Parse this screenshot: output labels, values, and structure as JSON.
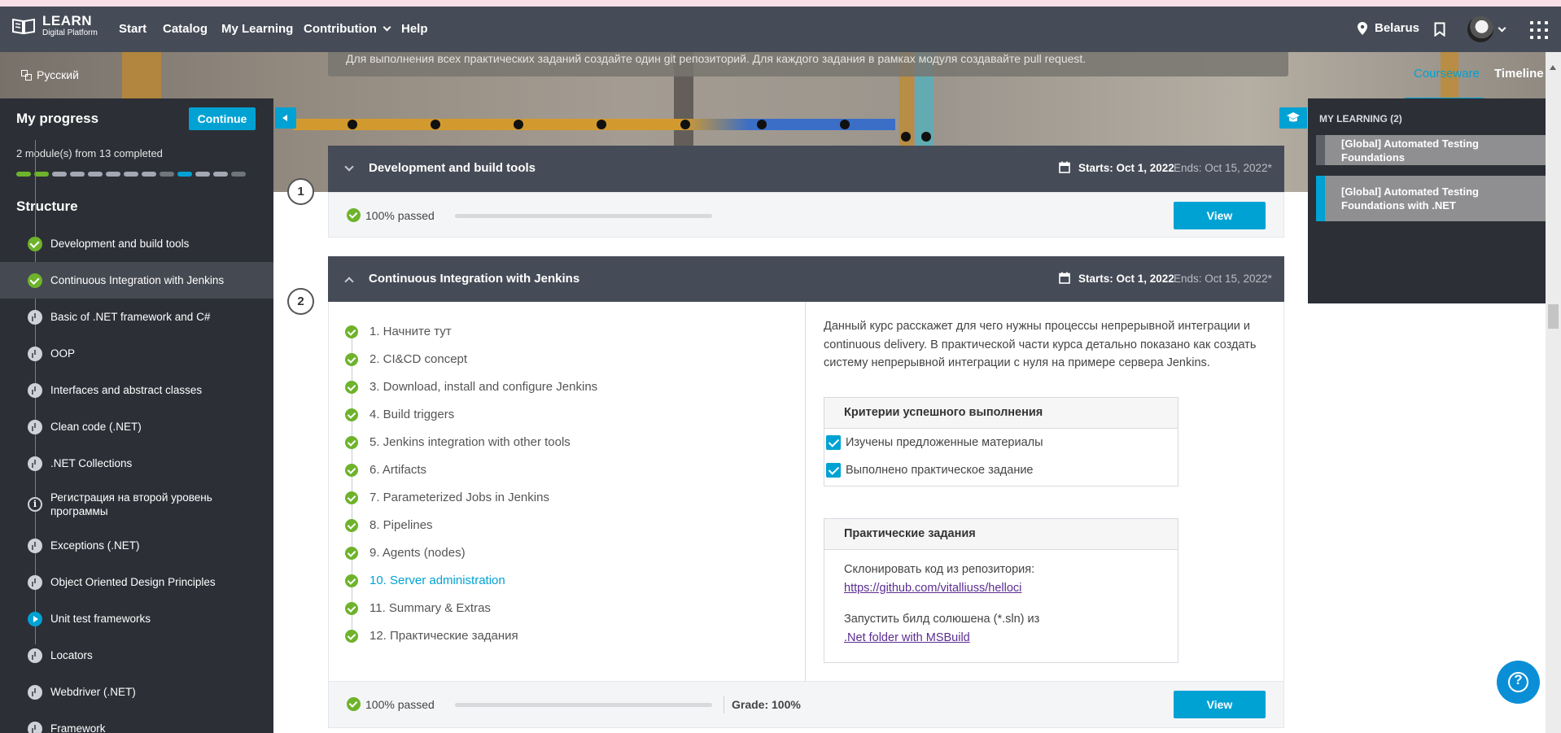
{
  "nav": {
    "logo_title": "LEARN",
    "logo_subtitle": "Digital Platform",
    "items": [
      "Start",
      "Catalog",
      "My Learning",
      "Contribution",
      "Help"
    ],
    "region": "Belarus"
  },
  "banner": {
    "language": "Русский",
    "notice": "Для выполнения всех практических заданий создайте один git репозиторий. Для каждого задания в рамках модуля создавайте pull request.",
    "tabs": [
      "Courseware",
      "Timeline"
    ],
    "active_tab": "Courseware"
  },
  "sidebar": {
    "title": "My progress",
    "continue_label": "Continue",
    "modules_completed": "2 module(s) from 13 completed",
    "progress_completed": 2,
    "progress_total": 13,
    "structure_title": "Structure",
    "items": [
      {
        "label": "Development and build tools",
        "status": "done"
      },
      {
        "label": "Continuous Integration with Jenkins",
        "status": "done"
      },
      {
        "label": "Basic of .NET framework and C#",
        "status": "pending"
      },
      {
        "label": "OOP",
        "status": "pending"
      },
      {
        "label": "Interfaces and abstract classes",
        "status": "pending"
      },
      {
        "label": "Clean code (.NET)",
        "status": "pending"
      },
      {
        "label": ".NET Collections",
        "status": "pending"
      },
      {
        "label": "Регистрация на второй уровень программы",
        "status": "info"
      },
      {
        "label": "Exceptions (.NET)",
        "status": "pending"
      },
      {
        "label": "Object Oriented Design Principles",
        "status": "pending"
      },
      {
        "label": "Unit test frameworks",
        "status": "in-progress"
      },
      {
        "label": "Locators",
        "status": "pending"
      },
      {
        "label": "Webdriver (.NET)",
        "status": "pending"
      },
      {
        "label": "Framework",
        "status": "pending"
      }
    ]
  },
  "right_panel": {
    "title": "MY LEARNING (2)",
    "items": [
      "[Global] Automated Testing Foundations",
      "[Global] Automated Testing Foundations with .NET"
    ]
  },
  "modules": [
    {
      "number": "1",
      "title": "Development and build tools",
      "starts": "Starts: Oct 1, 2022",
      "ends": "Ends: Oct 15, 2022*",
      "passed": "100% passed",
      "progress": 1.0,
      "view_label": "View"
    },
    {
      "number": "2",
      "title": "Continuous Integration with Jenkins",
      "starts": "Starts: Oct 1, 2022",
      "ends": "Ends: Oct 15, 2022*",
      "passed": "100% passed",
      "progress": 1.0,
      "grade": "Grade: 100%",
      "view_label": "View",
      "lessons": [
        "1. Начните тут",
        "2. CI&CD concept",
        "3. Download, install and configure Jenkins",
        "4. Build triggers",
        "5. Jenkins integration with other tools",
        "6. Artifacts",
        "7. Parameterized Jobs in Jenkins",
        "8. Pipelines",
        "9. Agents (nodes)",
        "10. Server administration",
        "11. Summary & Extras",
        "12. Практические задания"
      ],
      "current_lesson_index": 9,
      "description": " Данный курс расскажет для чего нужны процессы непрерывной интеграции и continuous delivery. В практической части курса детально показано как создать систему непрерывной интеграции с нуля на примере сервера Jenkins.",
      "criteria_title": "Критерии успешного выполнения",
      "criteria": [
        "Изучены предложенные материалы",
        "Выполнено практическое задание"
      ],
      "tasks_title": "Практические задания",
      "task1_text": "Склонировать код из репозитория:",
      "task1_link": "https://github.com/vitalliuss/helloci",
      "task2_text": "Запустить билд солюшена (*.sln) из",
      "task2_link": ".Net folder with MSBuild"
    }
  ]
}
